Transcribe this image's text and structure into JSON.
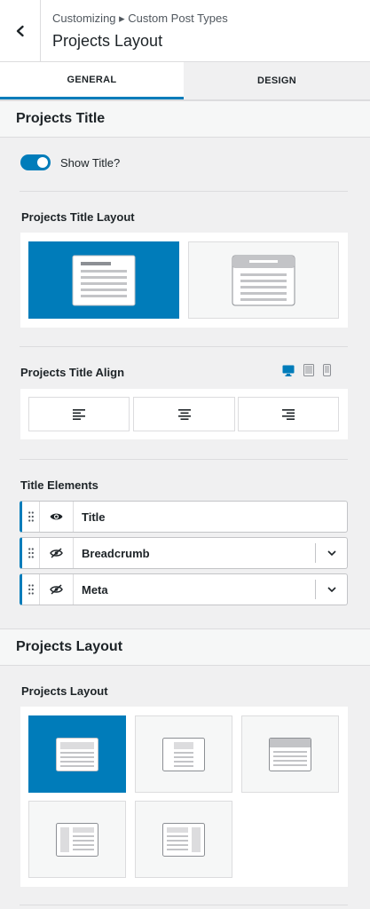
{
  "header": {
    "breadcrumb": "Customizing ▸ Custom Post Types",
    "title": "Projects Layout",
    "back_icon": "chevron-left-icon"
  },
  "tabs": [
    {
      "label": "GENERAL",
      "active": true
    },
    {
      "label": "DESIGN",
      "active": false
    }
  ],
  "projects_title_section": {
    "heading": "Projects Title",
    "show_title": {
      "label": "Show Title?",
      "enabled": true
    },
    "title_layout": {
      "label": "Projects Title Layout",
      "options": [
        {
          "name": "normal-title-layout-icon",
          "selected": true
        },
        {
          "name": "above-content-title-layout-icon",
          "selected": false
        }
      ]
    },
    "title_align": {
      "label": "Projects Title Align",
      "devices": [
        "desktop-icon",
        "tablet-icon",
        "mobile-icon"
      ],
      "active_device": "desktop-icon",
      "options": [
        "align-left-icon",
        "align-center-icon",
        "align-right-icon"
      ]
    },
    "title_elements": {
      "label": "Title Elements",
      "items": [
        {
          "label": "Title",
          "visible": true,
          "expandable": false
        },
        {
          "label": "Breadcrumb",
          "visible": false,
          "expandable": true
        },
        {
          "label": "Meta",
          "visible": false,
          "expandable": true
        }
      ]
    }
  },
  "projects_layout_section": {
    "heading": "Projects Layout",
    "layout": {
      "label": "Projects Layout",
      "options": [
        {
          "name": "fullwidth-layout-icon",
          "selected": true
        },
        {
          "name": "narrow-layout-icon",
          "selected": false
        },
        {
          "name": "wide-boxed-layout-icon",
          "selected": false
        },
        {
          "name": "left-sidebar-layout-icon",
          "selected": false
        },
        {
          "name": "right-sidebar-layout-icon",
          "selected": false
        }
      ]
    }
  },
  "colors": {
    "accent": "#007cba",
    "panel_bg": "#f0f0f1",
    "border": "#dcdcde"
  }
}
